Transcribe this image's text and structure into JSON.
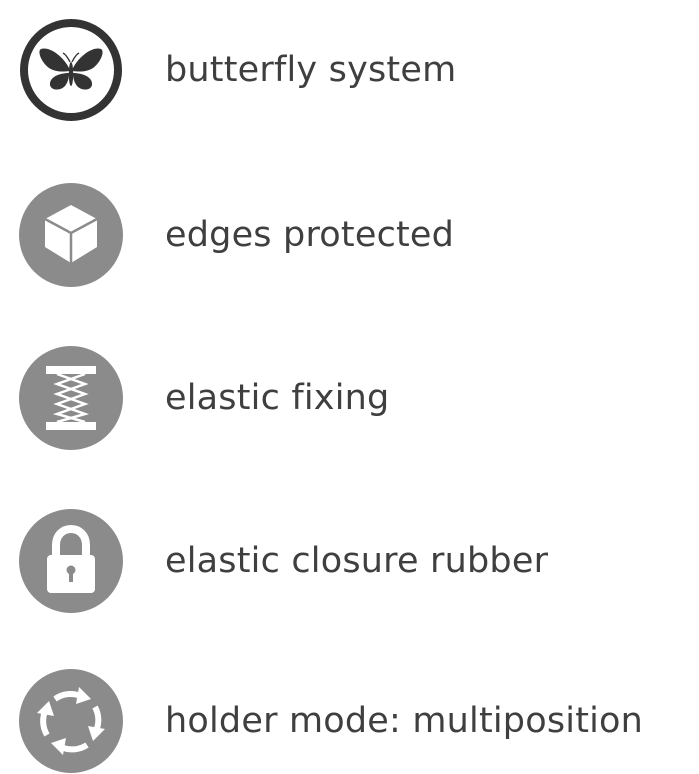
{
  "colors": {
    "icon_gray": "#8b8b8b",
    "icon_dark": "#333333",
    "text": "#3f3f3f",
    "background": "#ffffff"
  },
  "features": [
    {
      "label": "butterfly system",
      "icon": "butterfly-icon"
    },
    {
      "label": "edges protected",
      "icon": "cube-icon"
    },
    {
      "label": "elastic fixing",
      "icon": "spring-icon"
    },
    {
      "label": "elastic closure rubber",
      "icon": "padlock-icon"
    },
    {
      "label": "holder mode: multiposition",
      "icon": "rotate-arrows-icon"
    }
  ]
}
